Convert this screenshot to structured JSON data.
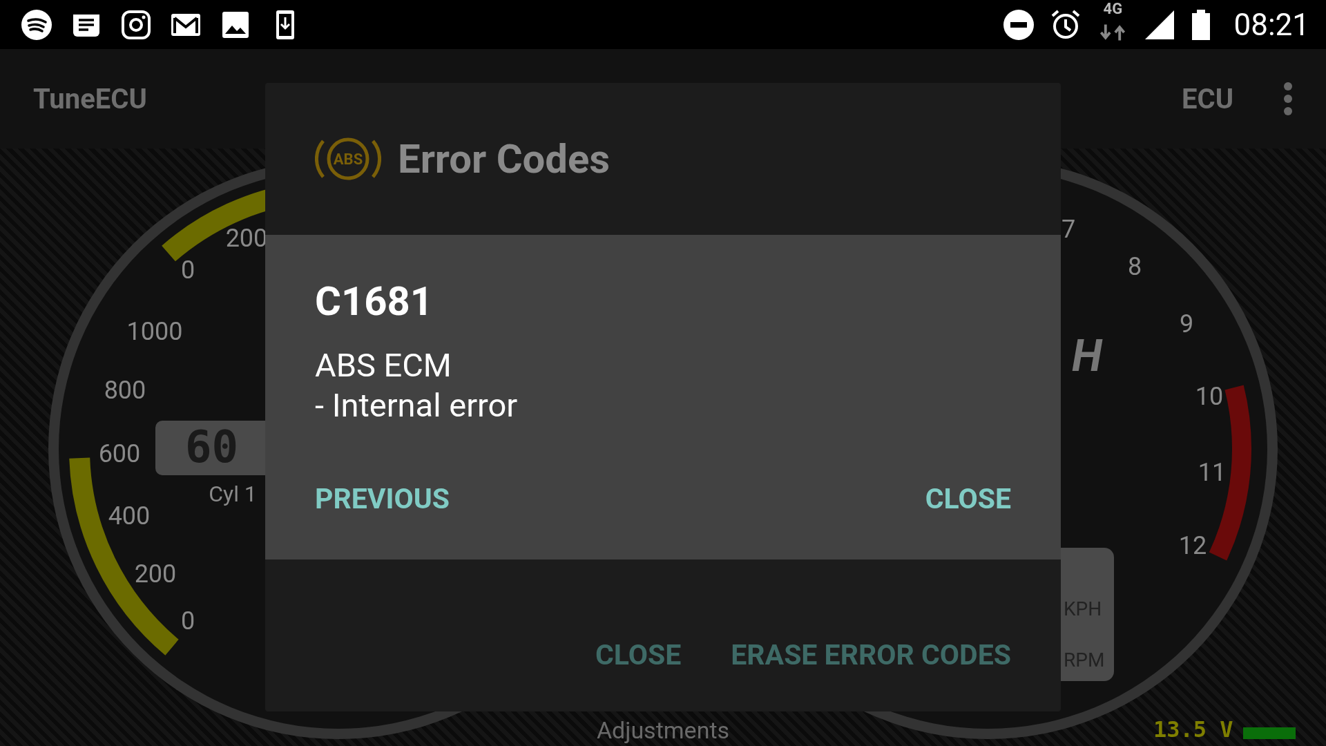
{
  "status_bar": {
    "network": "4G",
    "time": "08:21"
  },
  "app_bar": {
    "title": "TuneECU",
    "action": "ECU"
  },
  "left_gauge": {
    "labels": [
      "200",
      "0",
      "1000",
      "800",
      "600",
      "400",
      "200",
      "0"
    ],
    "display": "60",
    "caption": "Cyl 1"
  },
  "right_gauge": {
    "labels": [
      "7",
      "8",
      "9",
      "10",
      "11",
      "12"
    ],
    "unit": "H",
    "unit_toggle": [
      "KPH",
      "RPM"
    ]
  },
  "dialog": {
    "icon_label": "ABS",
    "title": "Error Codes",
    "code": "C1681",
    "description": [
      "ABS ECM",
      "- Internal error"
    ],
    "actions": [
      "PREVIOUS",
      "CLOSE"
    ],
    "footer_actions": [
      "CLOSE",
      "ERASE ERROR CODES"
    ]
  },
  "bottom": {
    "label": "Adjustments",
    "voltage": "13.5 V"
  }
}
